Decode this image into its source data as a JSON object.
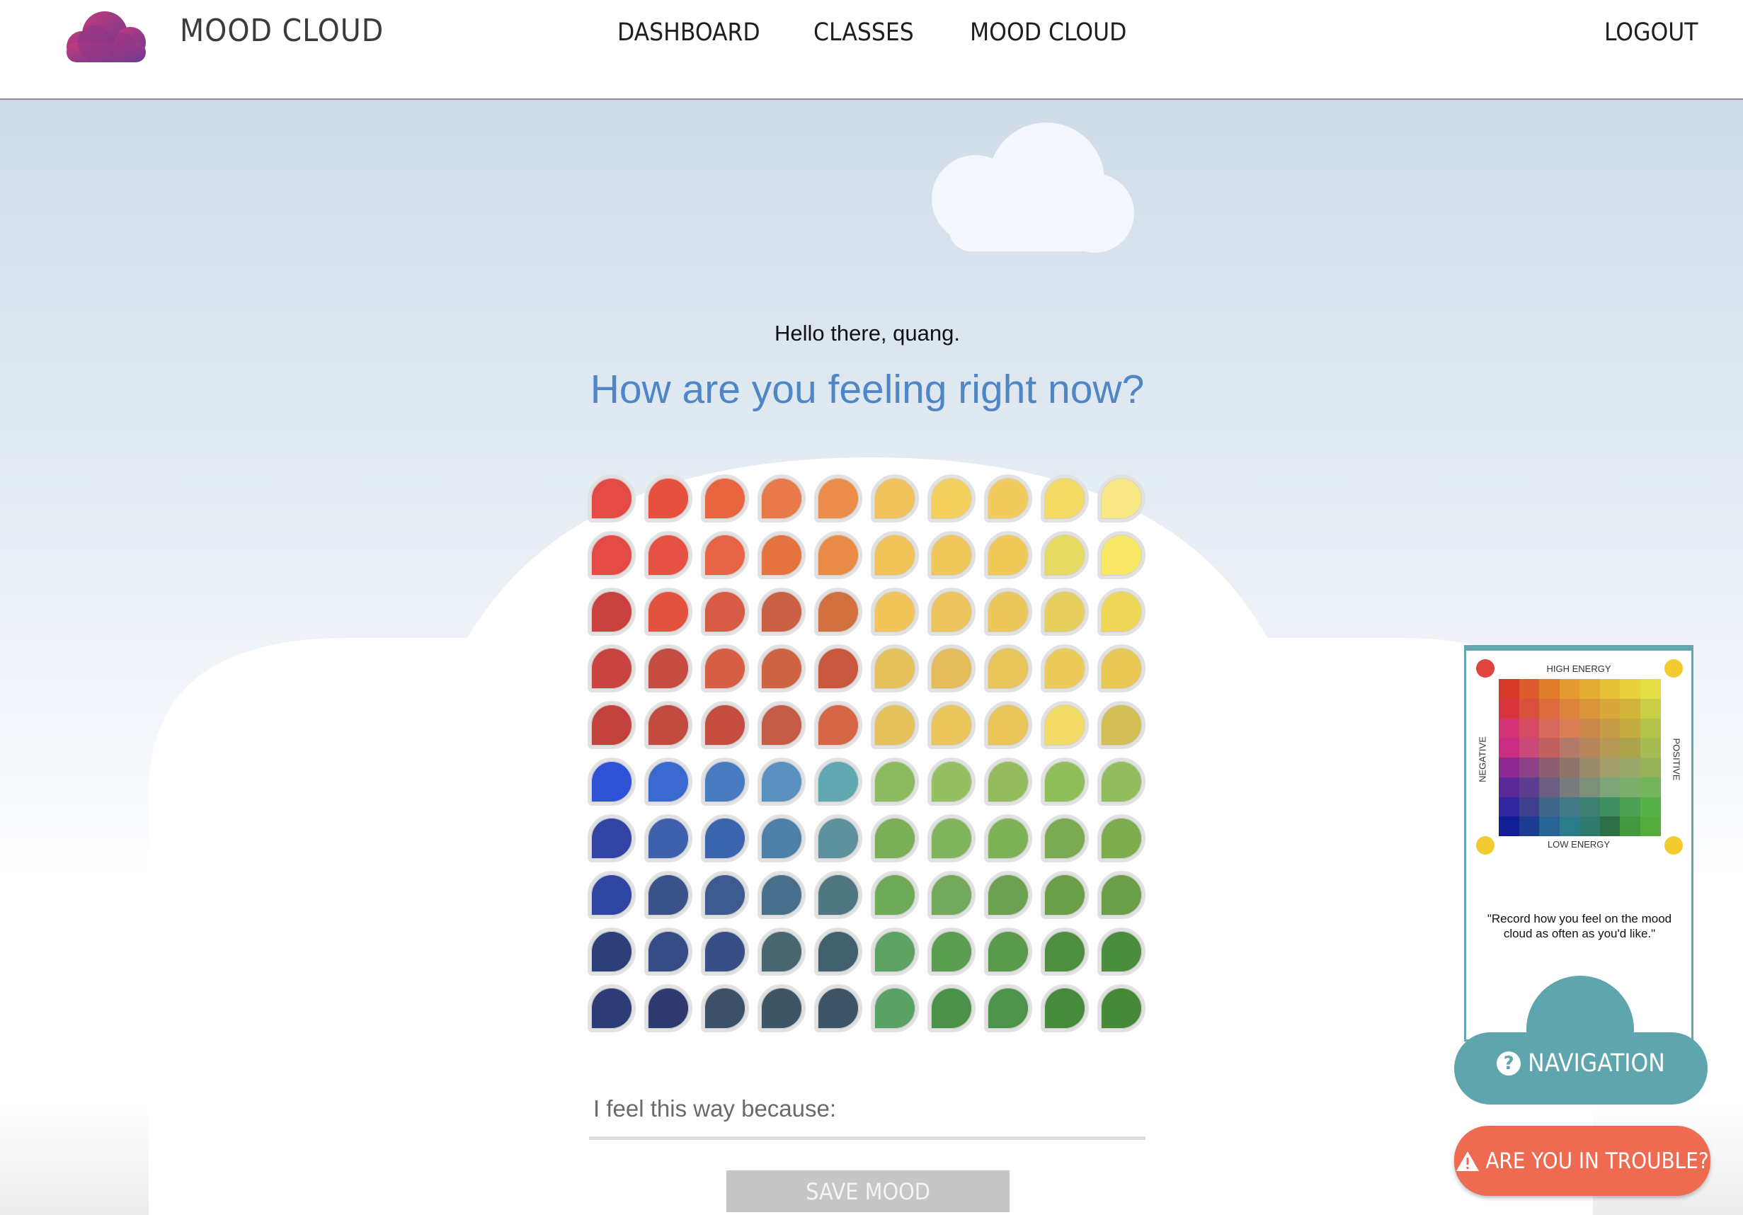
{
  "nav": {
    "brand": "MOOD CLOUD",
    "links": [
      "DASHBOARD",
      "CLASSES",
      "MOOD CLOUD"
    ],
    "logout": "LOGOUT"
  },
  "greeting": "Hello there, quang.",
  "question": "How are you feeling right now?",
  "mood_grid": {
    "rows": [
      [
        "#e44b45",
        "#e5503f",
        "#e8643f",
        "#e8794a",
        "#ec8c4a",
        "#f1c25c",
        "#f3cf5d",
        "#f1cb5d",
        "#f3db66",
        "#f9e785"
      ],
      [
        "#e44b44",
        "#e55143",
        "#e66445",
        "#e4733f",
        "#ea8a47",
        "#f1c258",
        "#f1c75b",
        "#f0c959",
        "#e6da63",
        "#f8e865"
      ],
      [
        "#c9423f",
        "#e2523f",
        "#d85b45",
        "#cb6144",
        "#d1703e",
        "#f1c55a",
        "#ecc35d",
        "#ecc75b",
        "#e7cf5f",
        "#eed656"
      ],
      [
        "#c94340",
        "#c44c40",
        "#d65e44",
        "#cd6342",
        "#c8583e",
        "#e4c15a",
        "#e4bc5b",
        "#e7c55b",
        "#ebcc5b",
        "#e8c855"
      ],
      [
        "#c3423d",
        "#c24b3f",
        "#c44d3f",
        "#c55c45",
        "#d46646",
        "#e5c15b",
        "#eac55b",
        "#e9c458",
        "#f3db68",
        "#d5bf57"
      ],
      [
        "#2d52d6",
        "#3a6acf",
        "#477abf",
        "#5a90c0",
        "#61a7b2",
        "#8cba5e",
        "#94c063",
        "#93bb5e",
        "#8ebd5a",
        "#91bc5d"
      ],
      [
        "#3245a5",
        "#3e60ad",
        "#3a64ad",
        "#4d80a9",
        "#5c909d",
        "#7aaf57",
        "#80b55d",
        "#7db257",
        "#7aaa51",
        "#7cac4e"
      ],
      [
        "#2f46a3",
        "#39528a",
        "#3d5b90",
        "#476f8b",
        "#4f7781",
        "#6faa58",
        "#72a95b",
        "#6ba151",
        "#6a9e49",
        "#6b9e48"
      ],
      [
        "#2d3f78",
        "#354c86",
        "#374f86",
        "#47666f",
        "#42616f",
        "#5ca262",
        "#5a9d50",
        "#5a9a4b",
        "#4f8e3f",
        "#4a8d3d"
      ],
      [
        "#2d3c77",
        "#2e3a70",
        "#3c5067",
        "#3d5565",
        "#3d5466",
        "#59a064",
        "#4a9249",
        "#4c934c",
        "#468a3b",
        "#468a37"
      ]
    ]
  },
  "reason": {
    "placeholder": "I feel this way because:"
  },
  "save_label": "SAVE MOOD",
  "help_card": {
    "top_label": "HIGH ENERGY",
    "bottom_label": "LOW ENERGY",
    "left_label": "NEGATIVE",
    "right_label": "POSITIVE",
    "quote": "\"Record how you feel on the mood cloud as often as you'd like.\"",
    "chart_colors": [
      [
        "#d73928",
        "#dc5a2b",
        "#e07d2d",
        "#e39a2e",
        "#e2ac33",
        "#e6c037",
        "#e9d23d",
        "#e3de46"
      ],
      [
        "#d8343d",
        "#d9503c",
        "#db6a3c",
        "#dc843c",
        "#d99538",
        "#d9a839",
        "#d3b43a",
        "#c9cf44"
      ],
      [
        "#d43473",
        "#d64b64",
        "#d86a5b",
        "#d97d55",
        "#c98849",
        "#c59c45",
        "#c4ac41",
        "#b3c34a"
      ],
      [
        "#c82d82",
        "#c94a79",
        "#c0605f",
        "#b3796a",
        "#b6855c",
        "#b59a55",
        "#aba44c",
        "#a7bb53"
      ],
      [
        "#8d2a92",
        "#8c4289",
        "#8d5e6f",
        "#8f7569",
        "#9a8c6a",
        "#a29e6e",
        "#9aa869",
        "#97b259"
      ],
      [
        "#5b2898",
        "#5d3d8f",
        "#6a5d82",
        "#7a7b7d",
        "#7b8f7b",
        "#7ea47a",
        "#7cae6c",
        "#72b55c"
      ],
      [
        "#33259d",
        "#3f3f8d",
        "#406689",
        "#417a86",
        "#3e8070",
        "#3f8e60",
        "#4da153",
        "#54b248"
      ],
      [
        "#131e96",
        "#1c3b91",
        "#266493",
        "#2c7b8b",
        "#2e7b6e",
        "#2d7048",
        "#44993f",
        "#52ad3c"
      ]
    ]
  },
  "navigation_label": "NAVIGATION",
  "trouble_label": "ARE YOU IN TROUBLE?",
  "colors": {
    "accent_blue": "#4f86c6",
    "teal": "#65a7b0",
    "trouble": "#ee6a50"
  }
}
